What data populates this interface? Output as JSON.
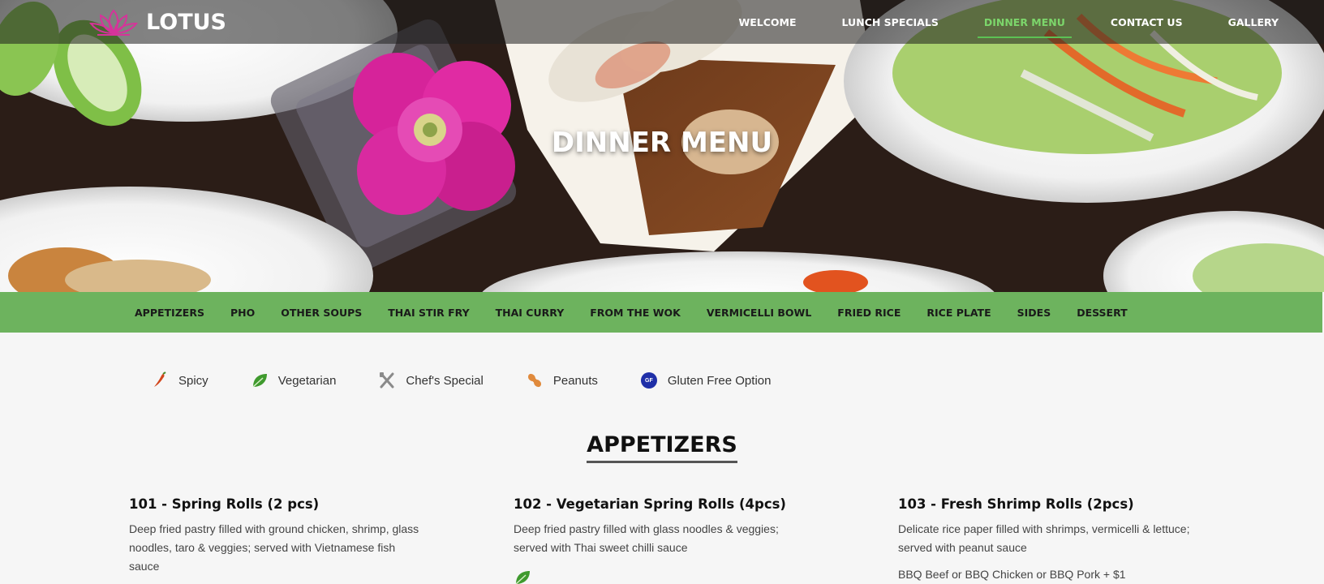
{
  "brand": {
    "name": "LOTUS",
    "logo_icon": "lotus-icon"
  },
  "nav": {
    "items": [
      {
        "label": "WELCOME",
        "active": false
      },
      {
        "label": "LUNCH SPECIALS",
        "active": false
      },
      {
        "label": "DINNER MENU",
        "active": true
      },
      {
        "label": "CONTACT US",
        "active": false
      },
      {
        "label": "GALLERY",
        "active": false
      }
    ]
  },
  "hero": {
    "title": "DINNER MENU"
  },
  "categories": [
    "APPETIZERS",
    "PHO",
    "OTHER SOUPS",
    "THAI STIR FRY",
    "THAI CURRY",
    "FROM THE WOK",
    "VERMICELLI BOWL",
    "FRIED RICE",
    "RICE PLATE",
    "SIDES",
    "DESSERT"
  ],
  "legend": [
    {
      "label": "Spicy",
      "icon": "chili-pepper-icon"
    },
    {
      "label": "Vegetarian",
      "icon": "leaf-icon"
    },
    {
      "label": "Chef's Special",
      "icon": "crossed-utensils-icon"
    },
    {
      "label": "Peanuts",
      "icon": "peanut-icon"
    },
    {
      "label": "Gluten Free Option",
      "icon": "gluten-free-icon",
      "badge": "GF"
    }
  ],
  "section": {
    "title": "APPETIZERS"
  },
  "menu_items": [
    {
      "title": "101 - Spring Rolls (2 pcs)",
      "description": "Deep fried pastry filled with ground chicken, shrimp, glass noodles, taro & veggies; served with Vietnamese fish sauce",
      "extra": ""
    },
    {
      "title": "102 - Vegetarian Spring Rolls (4pcs)",
      "description": "Deep fried pastry filled with glass noodles & veggies; served with Thai sweet chilli sauce",
      "extra": "",
      "icon": "leaf-icon"
    },
    {
      "title": "103 - Fresh Shrimp Rolls (2pcs)",
      "description": "Delicate rice paper filled with shrimps, vermicelli & lettuce; served with peanut sauce",
      "extra": "BBQ Beef or BBQ Chicken or BBQ Pork + $1"
    }
  ],
  "colors": {
    "accent_green": "#6db35e",
    "active_nav": "#7cd66b",
    "gf_blue": "#1f2fa8",
    "lotus_pink": "#d6339a"
  }
}
